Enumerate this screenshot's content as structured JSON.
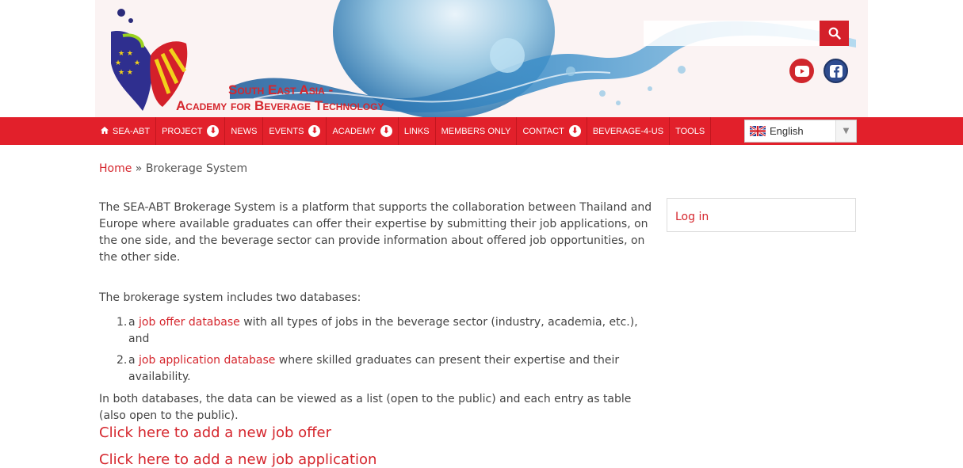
{
  "header": {
    "title_line1": "South East Asia -",
    "title_line2": "Academy for Beverage Technology",
    "search_placeholder": "",
    "social": [
      "youtube-icon",
      "facebook-icon"
    ]
  },
  "nav": {
    "items": [
      {
        "label": "SEA-ABT",
        "icon": "home-icon",
        "dropdown": false
      },
      {
        "label": "PROJECT",
        "dropdown": true
      },
      {
        "label": "NEWS",
        "dropdown": false
      },
      {
        "label": "EVENTS",
        "dropdown": true
      },
      {
        "label": "ACADEMY",
        "dropdown": true
      },
      {
        "label": "LINKS",
        "dropdown": false
      },
      {
        "label": "MEMBERS ONLY",
        "dropdown": false
      },
      {
        "label": "CONTACT",
        "dropdown": true
      },
      {
        "label": "BEVERAGE-4-US",
        "dropdown": false
      },
      {
        "label": "TOOLS",
        "dropdown": false
      }
    ],
    "language": "English"
  },
  "breadcrumb": {
    "home": "Home",
    "separator": "»",
    "current": "Brokerage System"
  },
  "content": {
    "intro": "The SEA-ABT Brokerage System is a platform that supports the collaboration between Thailand and Europe where available graduates can offer their expertise by submitting their job applications, on the one side, and the beverage sector can provide information about offered job opportunities, on the other side.",
    "databases_intro": "The brokerage system includes two databases:",
    "databases": [
      {
        "num": "1.",
        "prefix": "a ",
        "link": "job offer database",
        "suffix": " with all types of jobs in the beverage sector (industry, academia, etc.), and"
      },
      {
        "num": "2.",
        "prefix": "a ",
        "link": "job application database",
        "suffix": " where skilled graduates can present their expertise and their availability."
      }
    ],
    "both_text": "In both databases, the data can be viewed as a list (open to the public) and each entry as table (also open to the public).",
    "cta_offer": "Click here to add a new job offer",
    "cta_application": "Click here to add a new job application"
  },
  "sidebar": {
    "login": "Log in"
  },
  "colors": {
    "accent": "#e2202b",
    "link": "#d5262d",
    "text": "#444444"
  }
}
